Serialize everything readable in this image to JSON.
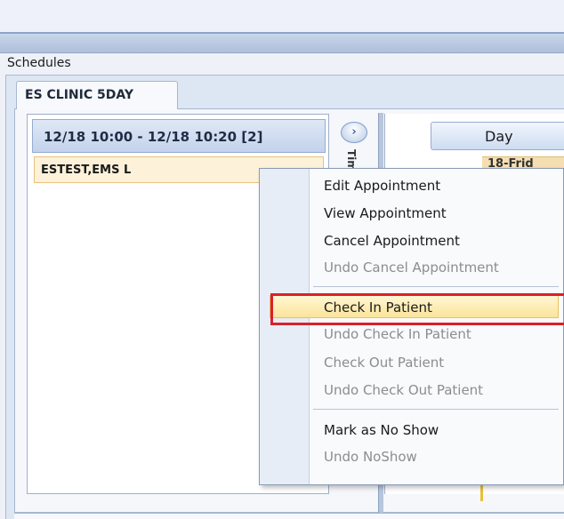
{
  "schedules": {
    "title": "Schedules",
    "tab_label": "ES CLINIC 5DAY"
  },
  "slot": {
    "header": "12/18 10:00 - 12/18 10:20  [2]",
    "appointment": "ESTEST,EMS L"
  },
  "nav": {
    "arrow": "›",
    "time_fragment": "Tim"
  },
  "day_view": {
    "day_label": "Day",
    "cell_fragment": "18-Frid"
  },
  "context_menu": {
    "edit": "Edit Appointment",
    "view": "View Appointment",
    "cancel": "Cancel Appointment",
    "undo_cancel": "Undo Cancel Appointment",
    "check_in": "Check In Patient",
    "undo_check_in": "Undo Check In Patient",
    "check_out": "Check Out Patient",
    "undo_check_out": "Undo Check Out Patient",
    "no_show": "Mark as No Show",
    "undo_no_show": "Undo NoShow"
  },
  "colors": {
    "highlight_border": "#d9202a",
    "menu_highlight": "#fbe49a",
    "appointment_bg": "#fdf2d9"
  }
}
